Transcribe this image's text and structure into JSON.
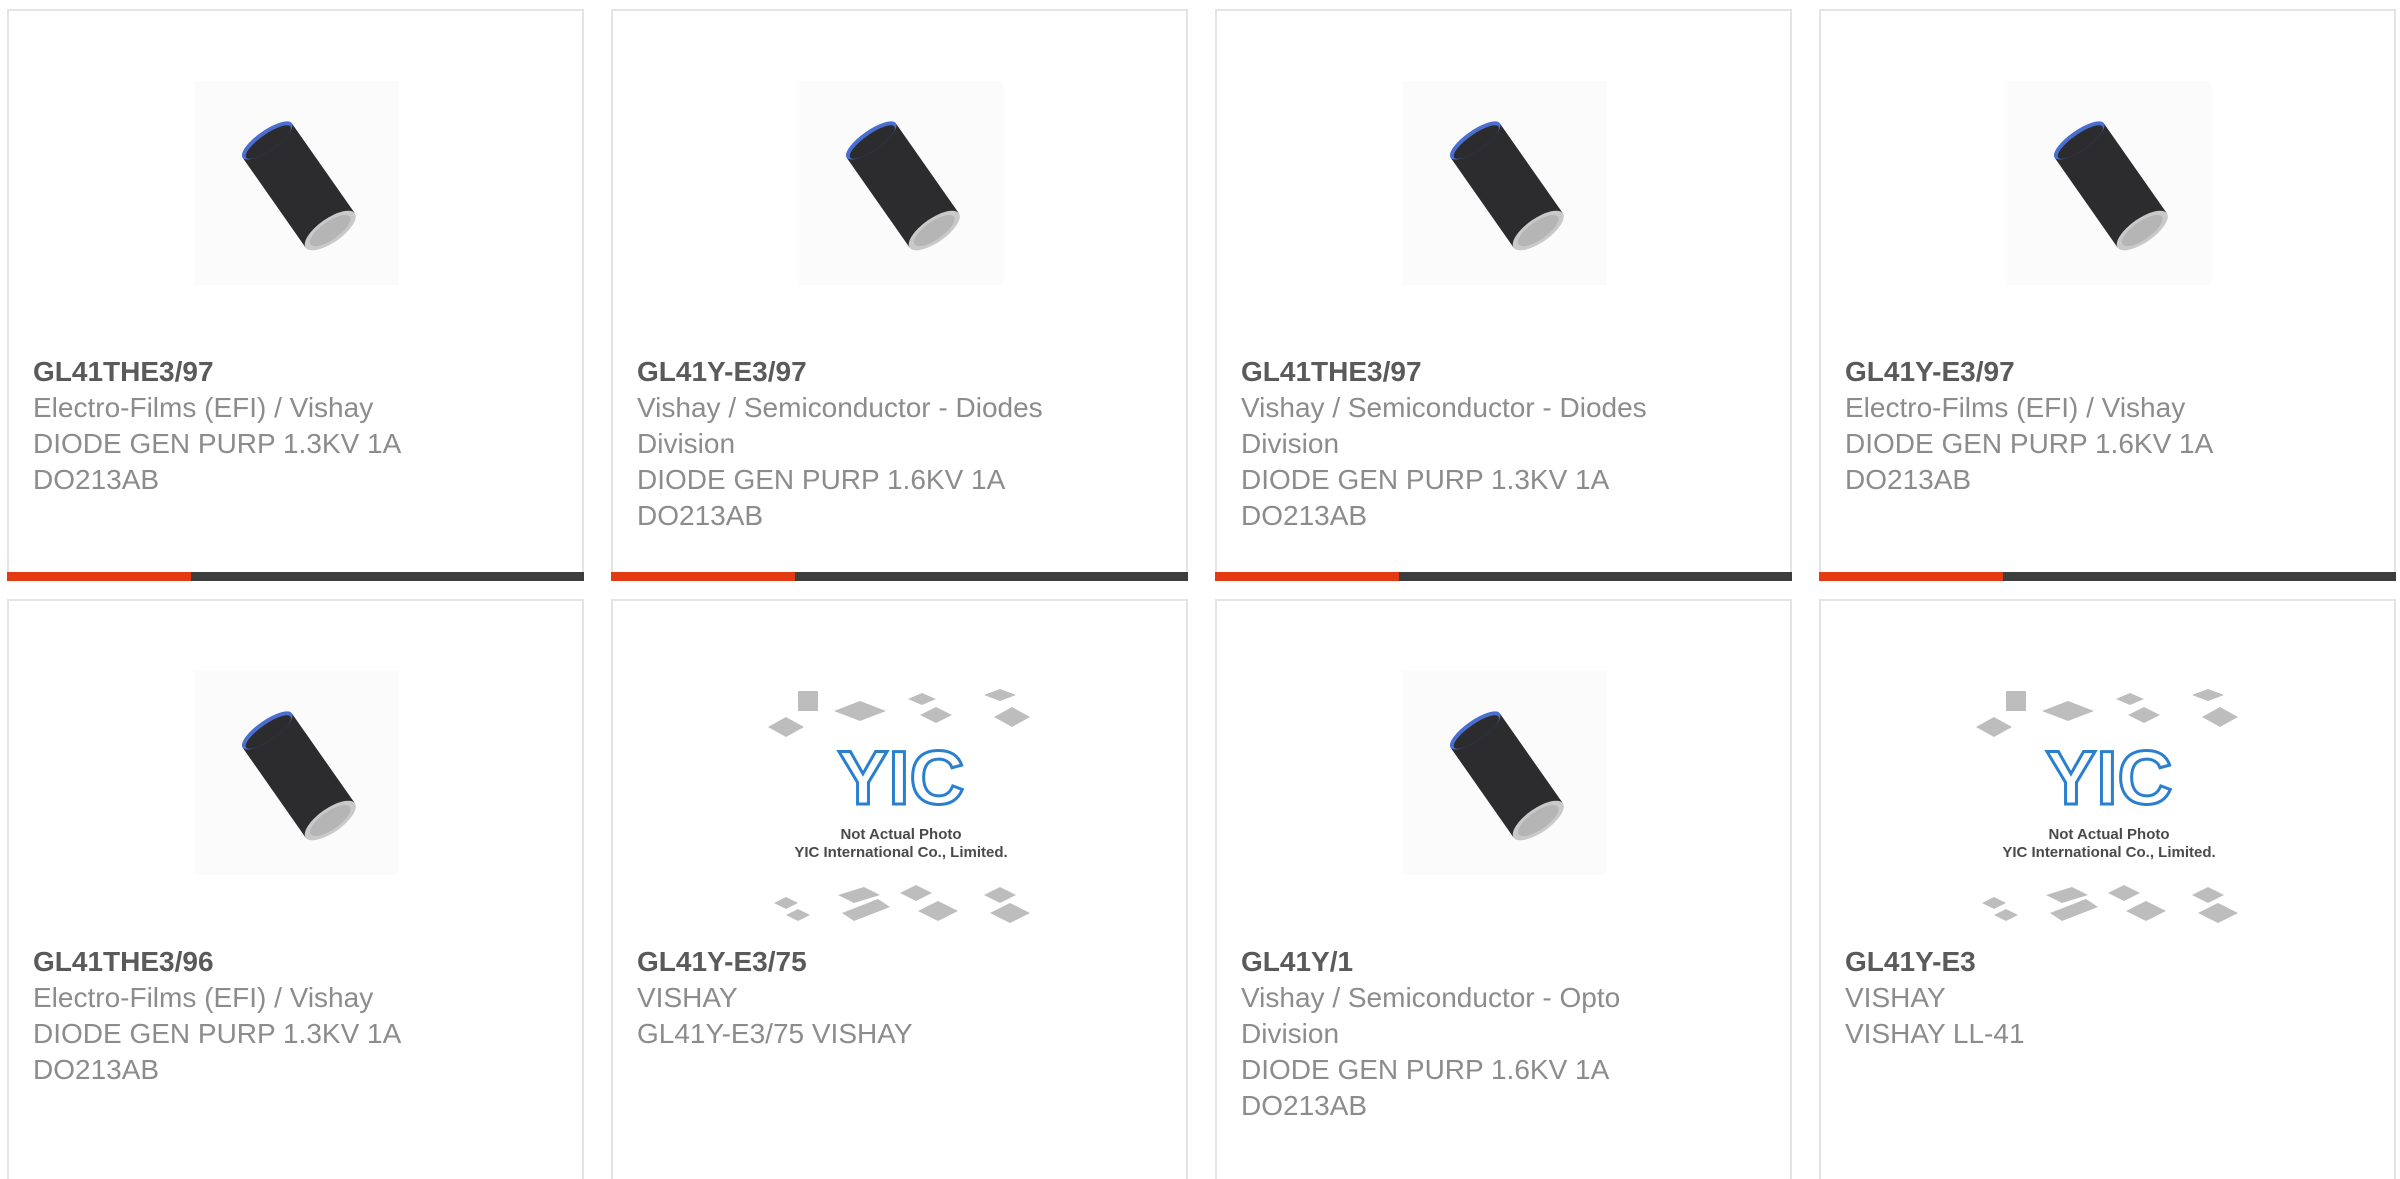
{
  "products": [
    {
      "part": "GL41THE3/97",
      "lines": [
        "Electro-Films (EFI) / Vishay",
        "DIODE GEN PURP 1.3KV 1A",
        "DO213AB"
      ],
      "image": "diode-cylinder-icon",
      "highlight": true
    },
    {
      "part": "GL41Y-E3/97",
      "lines": [
        "Vishay / Semiconductor - Diodes",
        "Division",
        "DIODE GEN PURP 1.6KV 1A",
        "DO213AB"
      ],
      "image": "diode-cylinder-icon",
      "highlight": true
    },
    {
      "part": "GL41THE3/97",
      "lines": [
        "Vishay / Semiconductor - Diodes",
        "Division",
        "DIODE GEN PURP 1.3KV 1A",
        "DO213AB"
      ],
      "image": "diode-cylinder-icon",
      "highlight": true
    },
    {
      "part": "GL41Y-E3/97",
      "lines": [
        "Electro-Films (EFI) / Vishay",
        "DIODE GEN PURP 1.6KV 1A",
        "DO213AB"
      ],
      "image": "diode-cylinder-icon",
      "highlight": true
    },
    {
      "part": "GL41THE3/96",
      "lines": [
        "Electro-Films (EFI) / Vishay",
        "DIODE GEN PURP 1.3KV 1A",
        "DO213AB"
      ],
      "image": "diode-cylinder-icon",
      "highlight": false
    },
    {
      "part": "GL41Y-E3/75",
      "lines": [
        "VISHAY",
        "GL41Y-E3/75 VISHAY"
      ],
      "image": "yic-placeholder-image",
      "highlight": false
    },
    {
      "part": "GL41Y/1",
      "lines": [
        "Vishay / Semiconductor - Opto",
        "Division",
        "DIODE GEN PURP 1.6KV 1A",
        "DO213AB"
      ],
      "image": "diode-cylinder-icon",
      "highlight": false
    },
    {
      "part": "GL41Y-E3",
      "lines": [
        "VISHAY",
        "VISHAY LL-41"
      ],
      "image": "yic-placeholder-image",
      "highlight": false
    }
  ],
  "placeholder": {
    "logo_text": "YIC",
    "caption_1": "Not Actual Photo",
    "caption_2": "YIC International Co., Limited."
  },
  "colors": {
    "accent_bar": "#e23a12",
    "dark_bar": "#3d3d3d",
    "part_text": "#5a5a5a",
    "body_text": "#8c8c8c"
  }
}
